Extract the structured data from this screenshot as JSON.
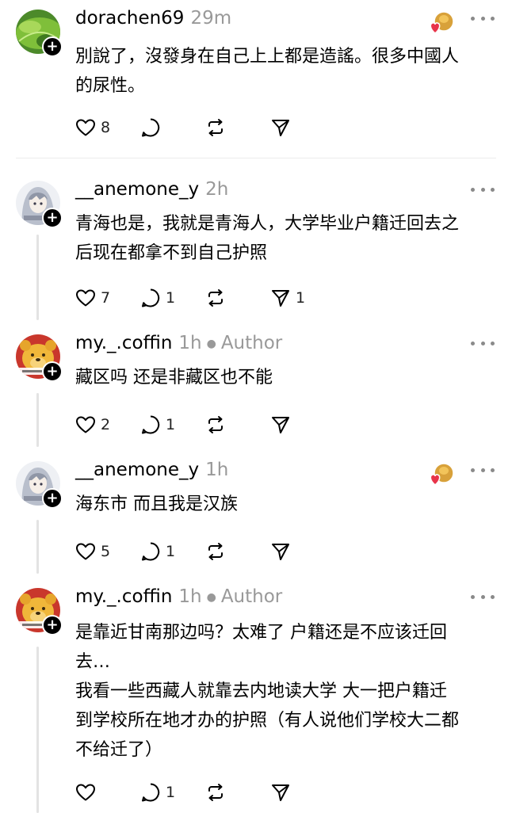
{
  "posts": [
    {
      "username": "dorachen69",
      "time": "29m",
      "author_tag": "",
      "lines": [
        "別說了，沒發身在自己上上都是造謠。很多中國人",
        "的尿性。"
      ],
      "likes": "8",
      "replies": "",
      "reposts": "",
      "shares": "",
      "avatar": "green-leaf-avatar",
      "liked_by_author_badge": true
    },
    {
      "username": "__anemone_y",
      "time": "2h",
      "author_tag": "",
      "lines": [
        "青海也是，我就是青海人，大学毕业户籍迁回去之",
        "后现在都拿不到自己护照"
      ],
      "likes": "7",
      "replies": "1",
      "reposts": "",
      "shares": "1",
      "avatar": "anime-girl-avatar",
      "liked_by_author_badge": false
    },
    {
      "username": "my._.coffin",
      "time": "1h",
      "author_tag": "Author",
      "lines": [
        "藏区吗 还是非藏区也不能"
      ],
      "likes": "2",
      "replies": "1",
      "reposts": "",
      "shares": "",
      "avatar": "pooh-bear-avatar",
      "liked_by_author_badge": false
    },
    {
      "username": "__anemone_y",
      "time": "1h",
      "author_tag": "",
      "lines": [
        "海东市 而且我是汉族"
      ],
      "likes": "5",
      "replies": "1",
      "reposts": "",
      "shares": "",
      "avatar": "anime-girl-avatar",
      "liked_by_author_badge": true
    },
    {
      "username": "my._.coffin",
      "time": "1h",
      "author_tag": "Author",
      "lines": [
        "是靠近甘南那边吗？太难了 户籍还是不应该迁回",
        "去…",
        "我看一些西藏人就靠去内地读大学 大一把户籍迁",
        "到学校所在地才办的护照（有人说他们学校大二都",
        "不给迁了）"
      ],
      "likes": "",
      "replies": "1",
      "reposts": "",
      "shares": "",
      "avatar": "pooh-bear-avatar",
      "liked_by_author_badge": false
    }
  ],
  "colors": {
    "text": "#000000",
    "meta": "#999999",
    "thread_line": "#e3e3e3",
    "heart_badge": "#e8344a"
  }
}
